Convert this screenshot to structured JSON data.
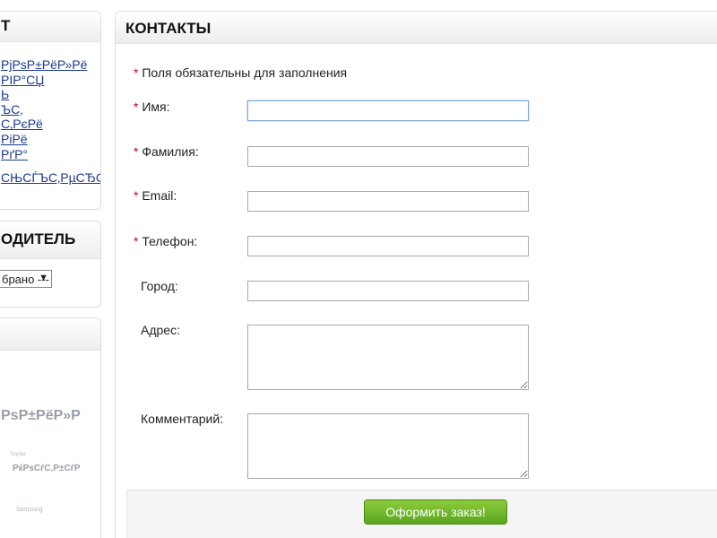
{
  "sidebar": {
    "panel1": {
      "title": "Т",
      "links": [
        "РјРѕР±РёР»Рё",
        "РІР°СЏ",
        "Ь",
        "ЪС‚",
        "С‚РєРё",
        "РіРё",
        "РґР°",
        "СЊСЃЪС‚РµСЂСЃС"
      ]
    },
    "panel2": {
      "title": "ОДИТЕЛЬ",
      "select_value": "брано ---",
      "select_arrow": "▼"
    },
    "panel3": {
      "title": "",
      "brand_big": "РѕР±РёР»Р",
      "brand_tiny": "Toyota",
      "brand_mid": "РќРѕСѓС‚Р±СѓР",
      "brand_samsung": "Samsung"
    }
  },
  "main": {
    "title": "КОНТАКТЫ",
    "required_marker": "*",
    "required_note": "Поля обязательны для заполнения",
    "fields": {
      "name": {
        "label": "Имя:",
        "value": ""
      },
      "surname": {
        "label": "Фамилия:",
        "value": ""
      },
      "email": {
        "label": "Email:",
        "value": ""
      },
      "phone": {
        "label": "Телефон:",
        "value": ""
      },
      "city": {
        "label": "Город:",
        "value": ""
      },
      "address": {
        "label": "Адрес:",
        "value": ""
      },
      "comment": {
        "label": "Комментарий:",
        "value": ""
      }
    },
    "submit_label": "Оформить заказ!"
  },
  "colors": {
    "required": "#d0021b",
    "link": "#1a3a8f",
    "button": "#6cb52a"
  }
}
